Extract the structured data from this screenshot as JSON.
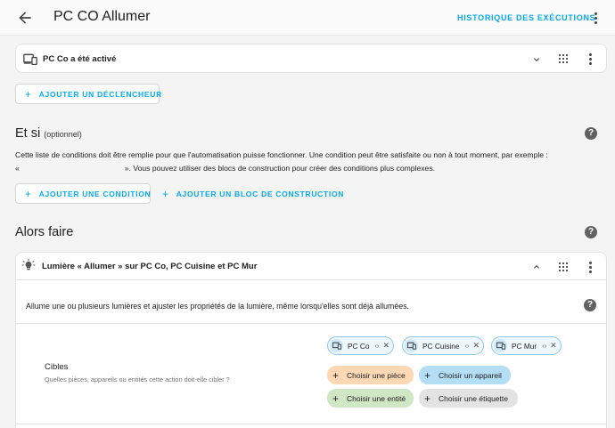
{
  "header": {
    "title": "PC CO Allumer",
    "history_label": "HISTORIQUE DES EXÉCUTIONS"
  },
  "trigger": {
    "label": "PC Co a été activé",
    "add_trigger_label": "AJOUTER UN DÉCLENCHEUR"
  },
  "conditions": {
    "title": "Et si",
    "optional": "(optionnel)",
    "description_line1": "Cette liste de conditions doit être remplie pour que l'automatisation puisse fonctionner. Une condition peut être satisfaite ou non à tout moment, par exemple :",
    "description_line2_start": "«",
    "description_line2_end": "». Vous pouvez utiliser des blocs de construction pour créer des conditions plus complexes.",
    "add_condition_label": "AJOUTER UNE CONDITION",
    "add_block_label": "AJOUTER UN BLOC DE CONSTRUCTION"
  },
  "actions": {
    "title": "Alors faire",
    "card_label": "Lumière « Allumer » sur PC Co, PC Cuisine et PC Mur",
    "card_description": "Allume une ou plusieurs lumières et ajuster les propriétés de la lumière, même lorsqu'elles sont déjà allumées.",
    "targets_label": "Cibles",
    "targets_sub": "Quelles pièces, appareils ou entités cette action doit-elle cibler ?",
    "chips": [
      {
        "label": "PC Co"
      },
      {
        "label": "PC Cuisine"
      },
      {
        "label": "PC Mur"
      }
    ],
    "choose_room": "Choisir une pièce",
    "choose_device": "Choisir un appareil",
    "choose_entity": "Choisir une entité",
    "choose_label": "Choisir une étiquette"
  },
  "help_glyph": "?",
  "plus_glyph": "+",
  "chip_ctrl_glyph": "‹›",
  "chip_close_glyph": "✕",
  "colors": {
    "accent": "#03a9f4",
    "room_pill": "#fcd8b5",
    "device_pill": "#b3def6",
    "entity_pill": "#cfe7c4",
    "label_pill": "#e3e3e3"
  },
  "icons": {
    "back": "arrow-left-icon",
    "device": "devices-icon",
    "light": "lightbulb-icon",
    "drag": "drag-handle-icon",
    "menu": "dots-vertical-icon",
    "expand": "chevron-down-icon",
    "collapse": "chevron-up-icon"
  }
}
